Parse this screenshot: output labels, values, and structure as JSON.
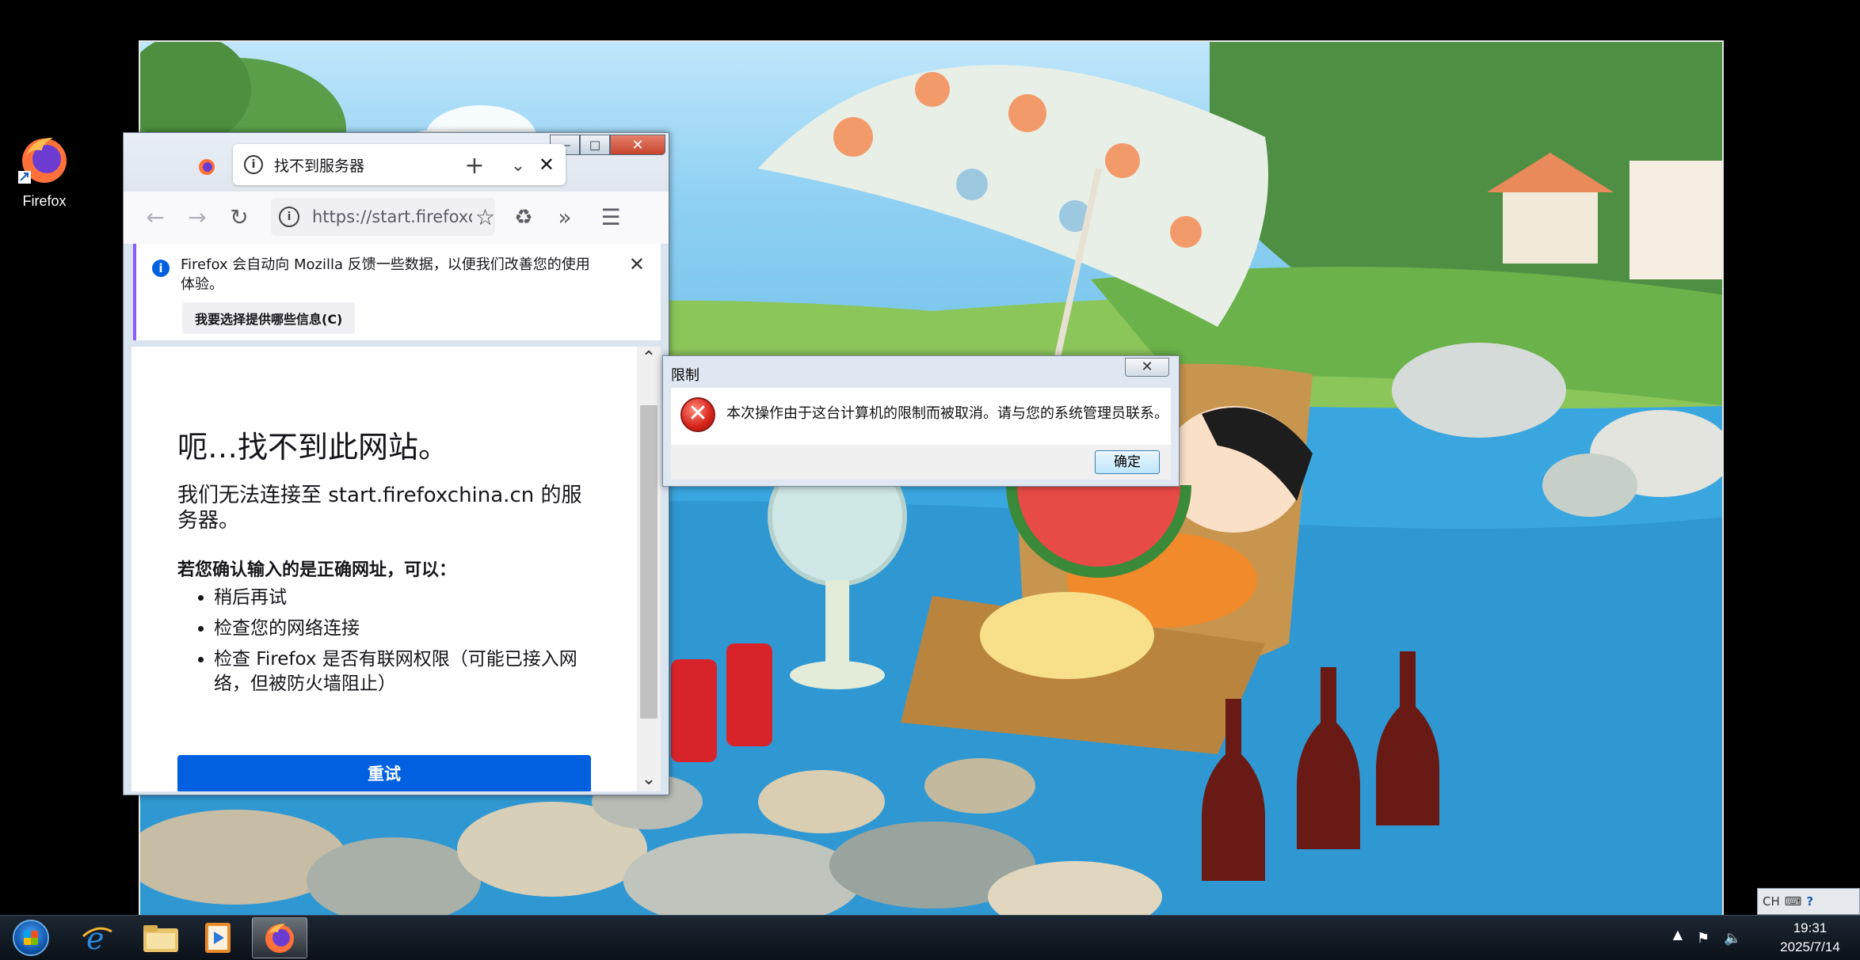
{
  "desktop": {
    "icons": [
      {
        "label": "Firefox"
      }
    ]
  },
  "firefox": {
    "tab_title": "找不到服务器",
    "url": "https://start.firefoxchina.cn",
    "notification": {
      "text": "Firefox 会自动向 Mozilla 反馈一些数据，以便我们改善您的使用体验。",
      "button": "我要选择提供哪些信息(C)"
    },
    "error": {
      "title": "呃…找不到此网站。",
      "description": "我们无法连接至 start.firefoxchina.cn 的服务器。",
      "subtitle": "若您确认输入的是正确网址，可以：",
      "items": [
        "稍后再试",
        "检查您的网络连接",
        "检查 Firefox 是否有联网权限（可能已接入网络，但被防火墙阻止）"
      ],
      "retry_label": "重试"
    }
  },
  "dialog": {
    "title": "限制",
    "message": "本次操作由于这台计算机的限制而被取消。请与您的系统管理员联系。",
    "ok_label": "确定"
  },
  "taskbar": {
    "language": "CH",
    "time": "19:31",
    "date": "2025/7/14"
  },
  "colors": {
    "accent": "#0060df",
    "error_red": "#d6231a"
  }
}
